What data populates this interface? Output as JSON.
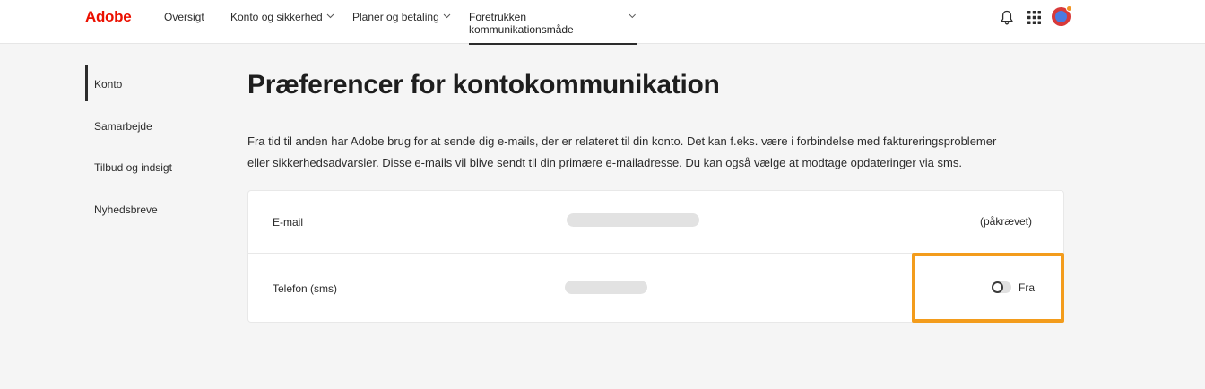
{
  "header": {
    "logo": "Adobe",
    "nav": [
      {
        "label": "Oversigt"
      },
      {
        "label": "Konto og sikkerhed"
      },
      {
        "label": "Planer og betaling"
      },
      {
        "label": "Foretrukken kommunikationsmåde"
      }
    ],
    "icons": [
      "bell-icon",
      "app-grid-icon",
      "avatar"
    ]
  },
  "sidebar": {
    "items": [
      {
        "label": "Konto"
      },
      {
        "label": "Samarbejde"
      },
      {
        "label": "Tilbud og indsigt"
      },
      {
        "label": "Nyhedsbreve"
      }
    ],
    "selected": "Konto"
  },
  "main": {
    "title": "Præferencer for kontokommunikation",
    "intro": "Fra tid til anden har Adobe brug for at sende dig e-mails, der er relateret til din konto. Det kan f.eks. være i forbindelse med faktureringsproblemer eller sikkerhedsadvarsler. Disse e-mails vil blive sendt til din primære e-mailadresse. Du kan også vælge at modtage opdateringer via sms.",
    "rows": [
      {
        "label": "E-mail",
        "status": "(påkrævet)"
      },
      {
        "label": "Telefon (sms)",
        "toggle_state": "off",
        "toggle_label": "Fra"
      }
    ]
  },
  "colors": {
    "brand": "#eb1000",
    "highlight": "#f39c1c"
  }
}
